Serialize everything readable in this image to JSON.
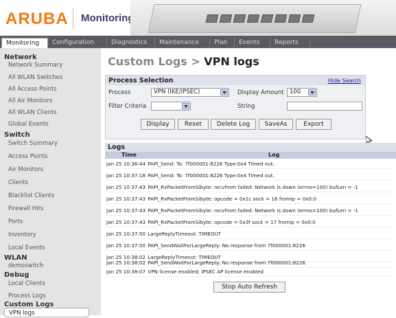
{
  "brand": {
    "logo": "ARUBA",
    "app_title": "Monitoring"
  },
  "tabs": [
    "Monitoring",
    "Configuration",
    "Diagnostics",
    "Maintenance",
    "Plan",
    "Events",
    "Reports"
  ],
  "active_tab": "Monitoring",
  "sidebar": {
    "sections": [
      {
        "title": "Network",
        "items": [
          "Network Summary",
          "All WLAN Switches",
          "All Access Points",
          "All Air Monitors",
          "All WLAN Clients",
          "Global Events"
        ]
      },
      {
        "title": "Switch",
        "items": [
          "Switch Summary",
          "Access Points",
          "Air Monitors",
          "Clients",
          "Blacklist Clients",
          "Firewall Hits",
          "Ports",
          "Inventory",
          "Local Events"
        ]
      },
      {
        "title": "WLAN",
        "items": [
          "demoswitch"
        ]
      },
      {
        "title": "Debug",
        "items": [
          "Local Clients",
          "Process Logs"
        ]
      },
      {
        "title": "Custom Logs",
        "items": [
          "VPN logs"
        ]
      }
    ],
    "selected": "VPN logs"
  },
  "page": {
    "crumb": "Custom Logs",
    "separator": " > ",
    "title": "VPN logs"
  },
  "process_selection": {
    "title": "Process Selection",
    "hide_link": "Hide Search",
    "process_label": "Process",
    "process_value": "VPN (IKE/IPSEC)",
    "display_amount_label": "Display Amount",
    "display_amount_value": "100",
    "filter_label": "Filter Criteria",
    "filter_value": "",
    "string_label": "String",
    "string_value": "",
    "buttons": {
      "display": "Display",
      "reset": "Reset",
      "delete": "Delete Log",
      "saveas": "SaveAs",
      "export": "Export"
    }
  },
  "logs": {
    "title": "Logs",
    "columns": {
      "time": "Time",
      "log": "Log"
    },
    "rows": [
      {
        "time": "Jan 25 10:36:44",
        "log": "PAPI_Send: To: 7f000001:8226 Type:0x4 Timed out."
      },
      {
        "time": "Jan 25 10:37:18",
        "log": "PAPI_Send: To: 7f000001:8226 Type:0x4 Timed out."
      },
      {
        "time": "Jan 25 10:37:43",
        "log": "PAPI_RxPacketFromSibyte: recvfrom failed: Network is down (errno=100) bufLen = -1"
      },
      {
        "time": "Jan 25 10:37:43",
        "log": "PAPI_RxPacketFromSibyte: opcode = 0x1c sock = 16 fromip = 0x0:0"
      },
      {
        "time": "Jan 25 10:37:43",
        "log": "PAPI_RxPacketFromSibyte: recvfrom failed: Network is down (errno=100) bufLen = -1"
      },
      {
        "time": "Jan 25 10:37:43",
        "log": "PAPI_RxPacketFromSibyte: opcode = 0x3f sock = 17 fromip = 0x0:0"
      },
      {
        "time": "Jan 25 10:37:50",
        "log": "LargeReplyTimeout: TIMEOUT"
      },
      {
        "time": "Jan 25 10:37:50",
        "log": "PAPI_SendWaitForLargeReply: No response from 7f000001:8226"
      },
      {
        "time": "Jan 25 10:38:02",
        "log": "LargeReplyTimeout: TIMEOUT"
      },
      {
        "time": "Jan 25 10:38:02",
        "log": "PAPI_SendWaitForLargeReply: No response from 7f000001:8226"
      },
      {
        "time": "Jan 25 10:38:07",
        "log": "VPN license enabled; IPSEC AP license enabled"
      }
    ],
    "stop_button": "Stop Auto Refresh"
  },
  "colors": {
    "brand_orange": "#f07b0f",
    "tab_bar": "#5a5a62",
    "sidebar_bg": "#e4e4e4",
    "panel_head": "#dde1ea"
  },
  "icons": {
    "cursor": "mouse-pointer-icon",
    "dropdown": "chevron-down-icon"
  }
}
